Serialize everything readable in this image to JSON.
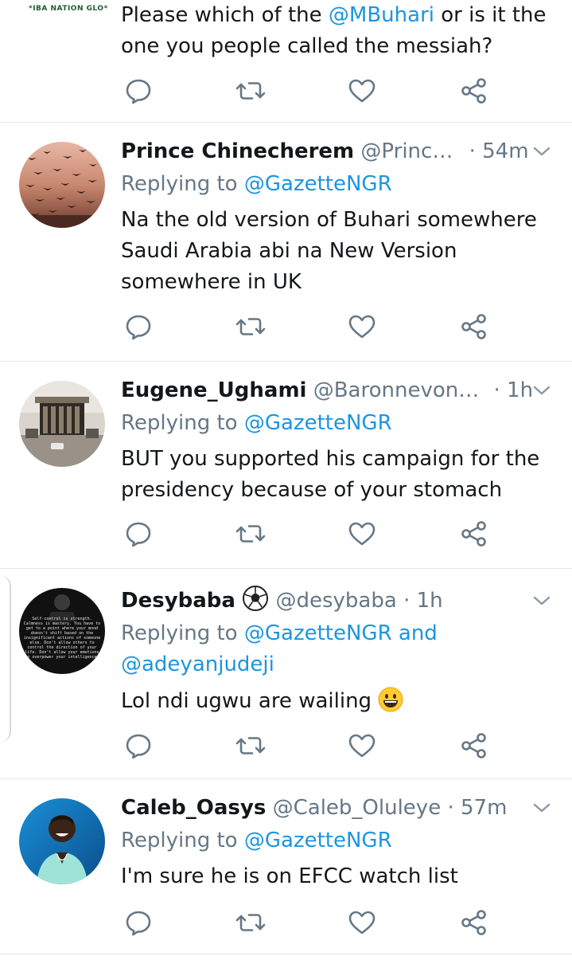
{
  "top_tweet": {
    "logo_text": "*IBA NATION GLO*",
    "text_prefix": "Please which of the ",
    "mention": "@MBuhari",
    "text_suffix": " or is it the one you people called the messiah?"
  },
  "tweets": [
    {
      "name": "Prince Chinecherem",
      "handle": "@Princ…",
      "time": "· 54m",
      "replying_prefix": "Replying to ",
      "replying_to": "@GazetteNGR",
      "text": "Na the old version of Buhari somewhere Saudi Arabia abi na New Version somewhere in UK"
    },
    {
      "name": "Eugene_Ughami",
      "handle": "@Baronnevon…",
      "time": "· 1h",
      "replying_prefix": "Replying to ",
      "replying_to": "@GazetteNGR",
      "text": "BUT you supported his campaign for the presidency because of your stomach"
    },
    {
      "name": "Desybaba",
      "handle": "@desybaba",
      "time": "· 1h",
      "replying_prefix": "Replying to ",
      "replying_to": "@GazetteNGR and",
      "replying_to_2": "@adeyanjudeji",
      "text": "Lol ndi ugwu are wailing",
      "avatar_text": "Self-control is strength. Calmness is mastery. You have to get to a point where your mood doesn't shift based on the insignificant actions of someone else. Don't allow others to control the direction of your life. Don't allow your emotions to overpower your intelligence."
    },
    {
      "name": "Caleb_Oasys",
      "handle": "@Caleb_Oluleye",
      "time": "· 57m",
      "replying_prefix": "Replying to ",
      "replying_to": "@GazetteNGR",
      "text": "I'm sure he is on EFCC watch list"
    }
  ],
  "icons": {
    "reply": "reply-icon",
    "retweet": "retweet-icon",
    "like": "heart-icon",
    "share": "share-icon",
    "more": "chevron-down-icon"
  },
  "colors": {
    "link": "#1b95e0",
    "secondary": "#657786",
    "divider": "#e1e8ed"
  }
}
